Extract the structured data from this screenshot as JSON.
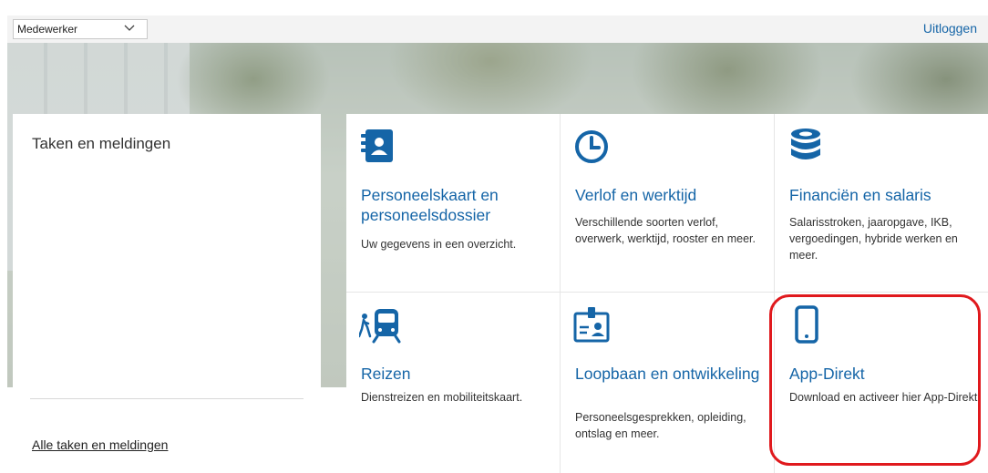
{
  "topbar": {
    "role_select": "Medewerker",
    "logout_label": "Uitloggen"
  },
  "tasks": {
    "title": "Taken en meldingen",
    "all_link": "Alle taken en meldingen"
  },
  "tiles": [
    {
      "title": "Personeelskaart en personeelsdossier",
      "description": "Uw gegevens in een overzicht.",
      "icon": "contact-card-icon"
    },
    {
      "title": "Verlof en werktijd",
      "description": "Verschillende soorten verlof, overwerk, werktijd, rooster en meer.",
      "icon": "clock-icon"
    },
    {
      "title": "Financiën en salaris",
      "description": "Salarisstroken, jaaropgave, IKB, vergoedingen, hybride werken en meer.",
      "icon": "coins-icon"
    },
    {
      "title": "Reizen",
      "description": "Dienstreizen en mobiliteitskaart.",
      "icon": "walker-train-icon"
    },
    {
      "title": "Loopbaan en ontwikkeling",
      "description": "Personeelsgesprekken, opleiding, ontslag en meer.",
      "icon": "id-badge-icon"
    },
    {
      "title": "App-Direkt",
      "description": "Download en activeer hier App-Direkt.",
      "icon": "smartphone-icon"
    }
  ],
  "colors": {
    "accent": "#1565a7",
    "highlight": "#e0191d"
  }
}
